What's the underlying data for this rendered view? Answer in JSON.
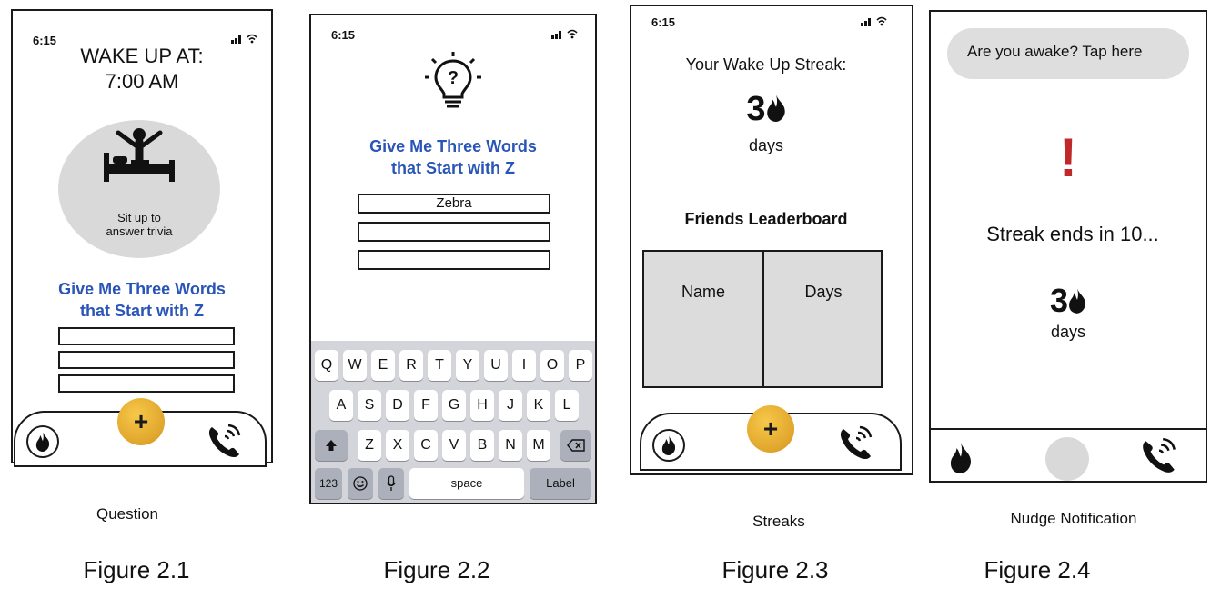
{
  "status_time": "6:15",
  "screen1": {
    "wake_title_line1": "WAKE UP AT:",
    "wake_title_line2": "7:00 AM",
    "circle_text_line1": "Sit up to",
    "circle_text_line2": "answer trivia",
    "question_line1": "Give Me Three Words",
    "question_line2": "that Start with Z",
    "fab_label": "+"
  },
  "screen2": {
    "question_line1": "Give Me Three Words",
    "question_line2": "that Start with Z",
    "answer1": "Zebra",
    "answer2": "",
    "answer3": "",
    "keyboard": {
      "row1": [
        "Q",
        "W",
        "E",
        "R",
        "T",
        "Y",
        "U",
        "I",
        "O",
        "P"
      ],
      "row2": [
        "A",
        "S",
        "D",
        "F",
        "G",
        "H",
        "J",
        "K",
        "L"
      ],
      "row3": [
        "Z",
        "X",
        "C",
        "V",
        "B",
        "N",
        "M"
      ],
      "numbers_key": "123",
      "space_key": "space",
      "return_key": "Label"
    }
  },
  "screen3": {
    "streak_title": "Your Wake Up Streak:",
    "streak_value": "3",
    "streak_unit": "days",
    "leaderboard_title": "Friends Leaderboard",
    "col_name": "Name",
    "col_days": "Days",
    "fab_label": "+"
  },
  "screen4": {
    "notification": "Are you awake? Tap here",
    "alert": "!",
    "countdown": "Streak ends in 10...",
    "streak_value": "3",
    "streak_unit": "days"
  },
  "captions": {
    "c1": "Question",
    "c3": "Streaks",
    "c4": "Nudge Notification"
  },
  "figures": {
    "f1": "Figure 2.1",
    "f2": "Figure 2.2",
    "f3": "Figure 2.3",
    "f4": "Figure 2.4"
  },
  "colors": {
    "accent_blue": "#2a55b8",
    "alert_red": "#c0282a",
    "fab_gold": "#e8ae32"
  }
}
